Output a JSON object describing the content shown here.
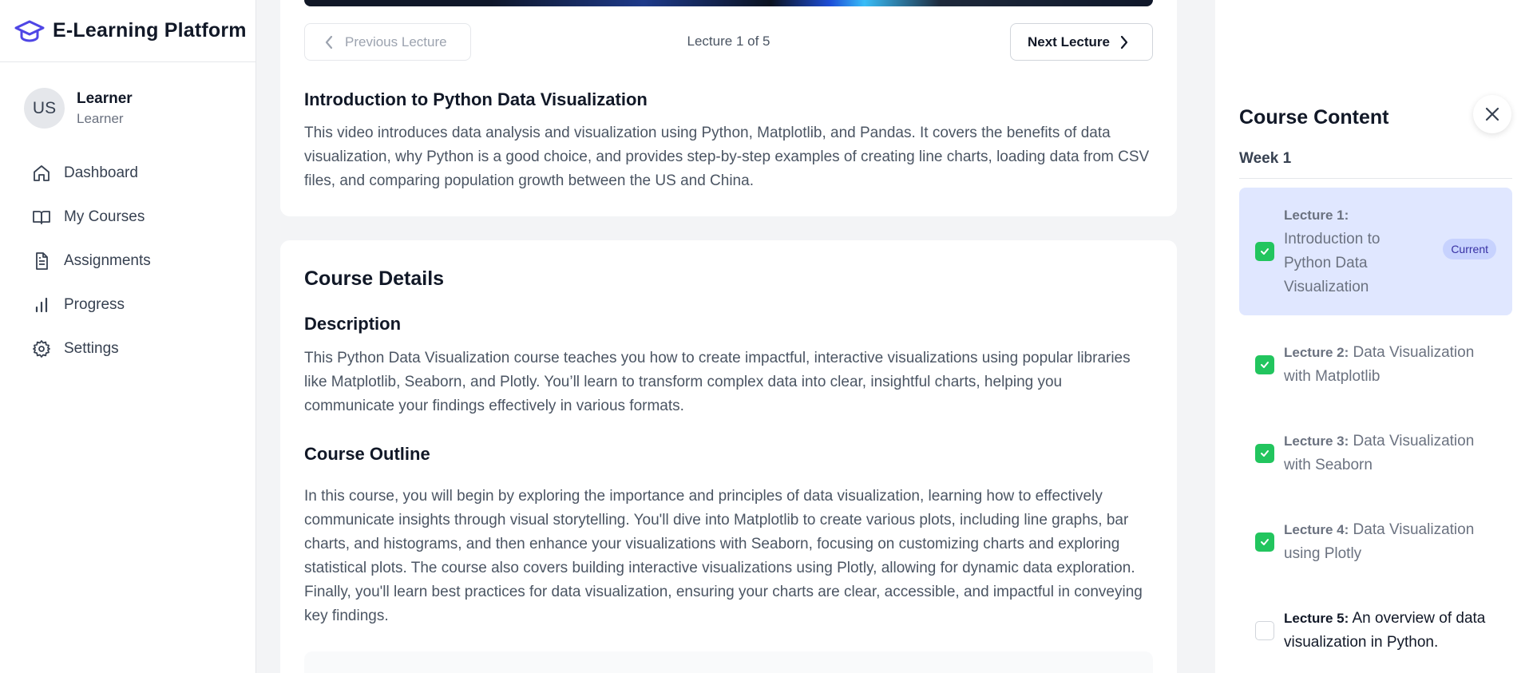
{
  "brand": {
    "title": "E-Learning Platform",
    "icon": "graduation-cap-icon",
    "color": "#4f46e5"
  },
  "user": {
    "initials": "US",
    "name": "Learner",
    "role": "Learner"
  },
  "nav": [
    {
      "label": "Dashboard",
      "icon": "home-icon"
    },
    {
      "label": "My Courses",
      "icon": "book-open-icon"
    },
    {
      "label": "Assignments",
      "icon": "document-icon"
    },
    {
      "label": "Progress",
      "icon": "bar-chart-icon"
    },
    {
      "label": "Settings",
      "icon": "gear-icon"
    }
  ],
  "lecture": {
    "prev_label": "Previous Lecture",
    "next_label": "Next Lecture",
    "counter": "Lecture 1 of 5",
    "title": "Introduction to Python Data Visualization",
    "description": "This video introduces data analysis and visualization using Python, Matplotlib, and Pandas. It covers the benefits of data visualization, why Python is a good choice, and provides step-by-step examples of creating line charts, loading data from CSV files, and comparing population growth between the US and China."
  },
  "details": {
    "title": "Course Details",
    "description_heading": "Description",
    "description": "This Python Data Visualization course teaches you how to create impactful, interactive visualizations using popular libraries like Matplotlib, Seaborn, and Plotly. You’ll learn to transform complex data into clear, insightful charts, helping you communicate your findings effectively in various formats.",
    "outline_heading": "Course Outline",
    "outline": "In this course, you will begin by exploring the importance and principles of data visualization, learning how to effectively communicate insights through visual storytelling. You'll dive into Matplotlib to create various plots, including line graphs, bar charts, and histograms, and then enhance your visualizations with Seaborn, focusing on customizing charts and exploring statistical plots. The course also covers building interactive visualizations using Plotly, allowing for dynamic data exploration. Finally, you'll learn best practices for data visualization, ensuring your charts are clear, accessible, and impactful in conveying key findings."
  },
  "panel": {
    "title": "Course Content",
    "week": "Week 1",
    "current_badge": "Current",
    "lectures": [
      {
        "num": "Lecture 1:",
        "title": "Introduction to Python Data Visualization",
        "done": true,
        "current": true
      },
      {
        "num": "Lecture 2:",
        "title": "Data Visualization with Matplotlib",
        "done": true,
        "current": false
      },
      {
        "num": "Lecture 3:",
        "title": "Data Visualization with Seaborn",
        "done": true,
        "current": false
      },
      {
        "num": "Lecture 4:",
        "title": "Data Visualization using Plotly",
        "done": true,
        "current": false
      },
      {
        "num": "Lecture 5:",
        "title": "An overview of data visualization in Python.",
        "done": false,
        "current": false
      }
    ]
  }
}
